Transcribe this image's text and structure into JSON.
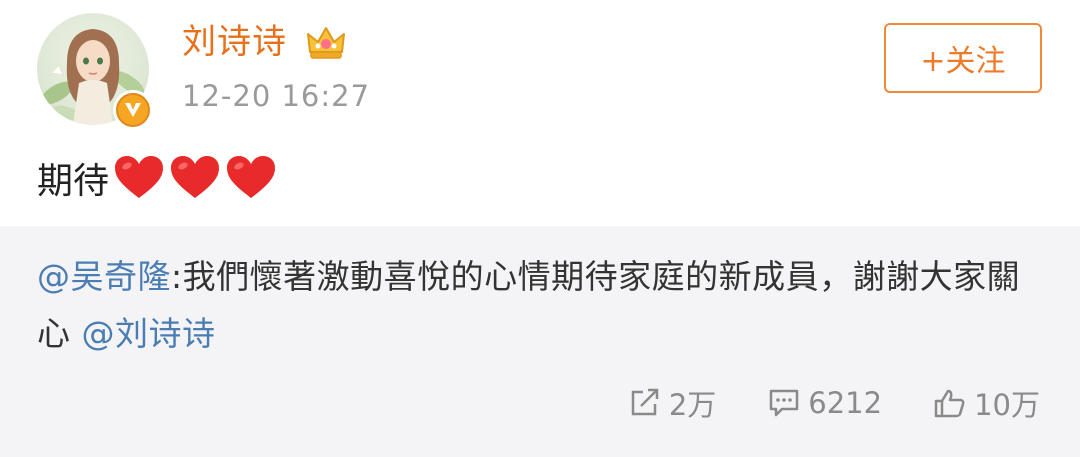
{
  "author": {
    "name": "刘诗诗",
    "timestamp": "12-20 16:27",
    "follow_label": "+关注",
    "name_color": "#e8701a"
  },
  "post": {
    "text": "期待",
    "hearts": [
      "heart-icon",
      "heart-icon",
      "heart-icon"
    ]
  },
  "repost": {
    "mention_author": "@吴奇隆",
    "separator": ":",
    "body": "我們懷著激動喜悅的心情期待家庭的新成員，謝謝大家關心 ",
    "mention_tag": "@刘诗诗",
    "mention_color": "#4a7db3"
  },
  "actions": {
    "repost_count": "2万",
    "comment_count": "6212",
    "like_count": "10万"
  }
}
